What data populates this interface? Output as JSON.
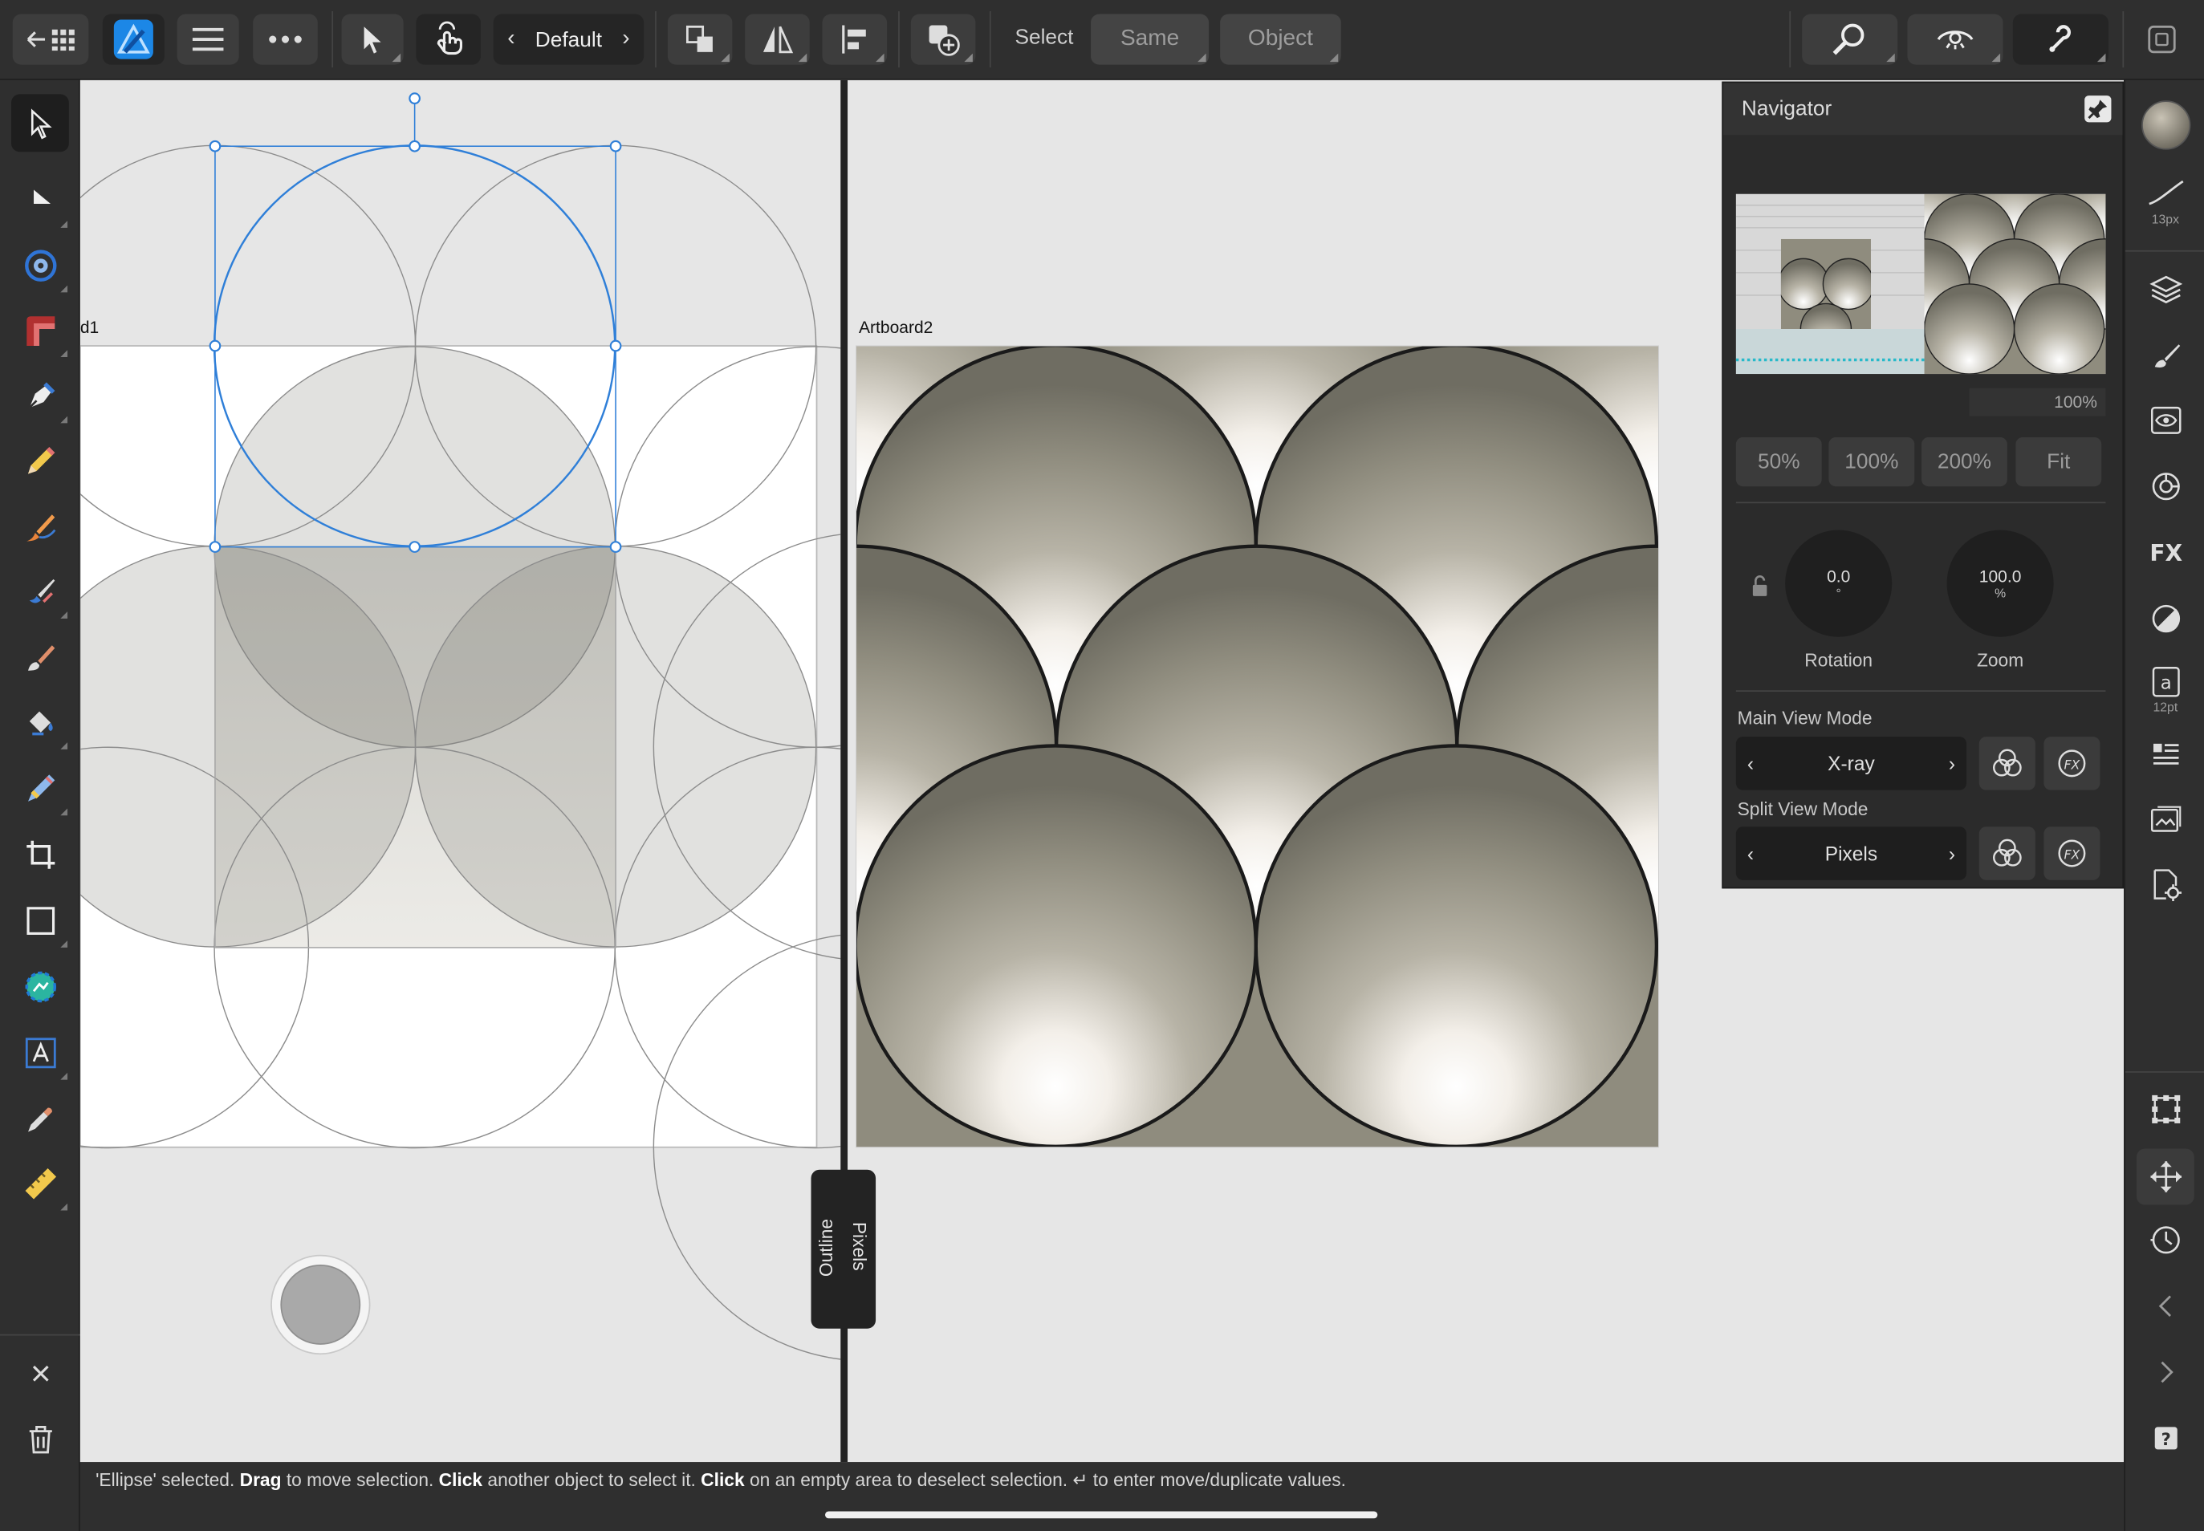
{
  "toolbar": {
    "preset_label": "Default",
    "select_label": "Select",
    "same_label": "Same",
    "object_label": "Object"
  },
  "canvas": {
    "artboard1_label": "d1",
    "artboard2_label": "Artboard2",
    "split_pill": {
      "outline": "Outline",
      "pixels": "Pixels"
    }
  },
  "navigator": {
    "title": "Navigator",
    "zoom_value": "100%",
    "zoom_buttons": [
      "50%",
      "100%",
      "200%",
      "Fit"
    ],
    "rotation": {
      "value": "0.0",
      "unit": "°",
      "label": "Rotation"
    },
    "zoom": {
      "value": "100.0",
      "unit": "%",
      "label": "Zoom"
    },
    "main_view_mode": {
      "label": "Main View Mode",
      "value": "X-ray"
    },
    "split_view_mode": {
      "label": "Split View Mode",
      "value": "Pixels"
    }
  },
  "rightbar": {
    "brush_size": "13px",
    "text_size": "12pt"
  },
  "status": {
    "p1": "'Ellipse' selected. ",
    "b1": "Drag",
    "p2": " to move selection. ",
    "b2": "Click",
    "p3": " another object to select it. ",
    "b3": "Click",
    "p4": " on an empty area to deselect selection. ↵ to enter move/duplicate values."
  },
  "colors": {
    "accent": "#1e7ad6",
    "selection": "#2f7fd8",
    "scale_dark": "#8f8c7e",
    "scale_light": "#f2f0ec"
  }
}
